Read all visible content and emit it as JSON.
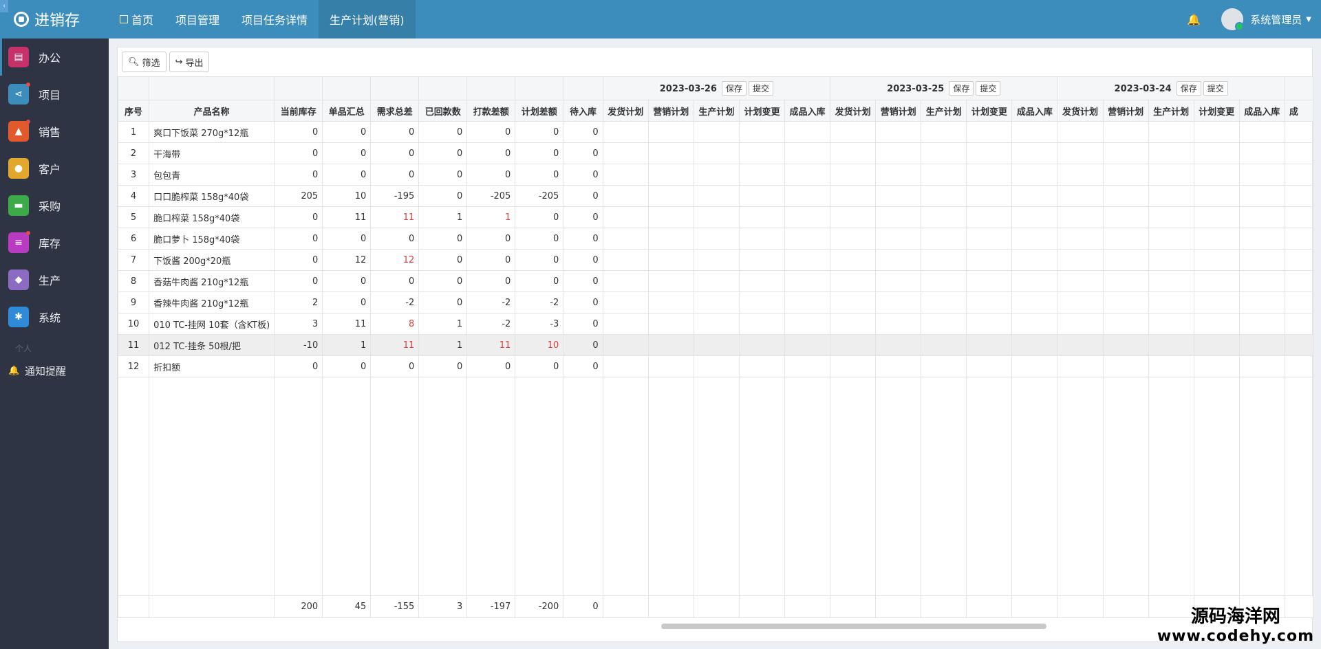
{
  "app": {
    "title": "进销存"
  },
  "sidebar": {
    "items": [
      {
        "label": "办公",
        "icon": "document-icon",
        "color": "#c73169",
        "dot": false
      },
      {
        "label": "项目",
        "icon": "share-icon",
        "color": "#3c8dbc",
        "dot": true
      },
      {
        "label": "销售",
        "icon": "road-icon",
        "color": "#e25a2c",
        "dot": true
      },
      {
        "label": "客户",
        "icon": "users-icon",
        "color": "#e3a82b",
        "dot": false
      },
      {
        "label": "采购",
        "icon": "cart-icon",
        "color": "#3daa4a",
        "dot": false
      },
      {
        "label": "库存",
        "icon": "database-icon",
        "color": "#b83bc1",
        "dot": true
      },
      {
        "label": "生产",
        "icon": "cube-icon",
        "color": "#8c6bc3",
        "dot": false
      },
      {
        "label": "系统",
        "icon": "gears-icon",
        "color": "#2f8ad8",
        "dot": false
      }
    ],
    "section_label": "个人",
    "notice_label": "通知提醒"
  },
  "topbar": {
    "tabs": [
      {
        "label": "首页",
        "active": false,
        "home": true
      },
      {
        "label": "项目管理",
        "active": false,
        "home": false
      },
      {
        "label": "项目任务详情",
        "active": false,
        "home": false
      },
      {
        "label": "生产计划(营销)",
        "active": true,
        "home": false
      }
    ],
    "user_name": "系统管理员"
  },
  "toolbar": {
    "filter_label": "筛选",
    "export_label": "导出"
  },
  "table": {
    "fixed_headers": [
      "序号",
      "产品名称",
      "当前库存",
      "单品汇总",
      "需求总差",
      "已回款数",
      "打款差额",
      "计划差额",
      "待入库"
    ],
    "date_groups": [
      {
        "date": "2023-03-26",
        "save": "保存",
        "submit": "提交"
      },
      {
        "date": "2023-03-25",
        "save": "保存",
        "submit": "提交"
      },
      {
        "date": "2023-03-24",
        "save": "保存",
        "submit": "提交"
      }
    ],
    "sub_headers": [
      "发货计划",
      "营销计划",
      "生产计划",
      "计划变更",
      "成品入库"
    ],
    "partial_header": "成",
    "rows": [
      {
        "no": "1",
        "name": "爽口下饭菜 270g*12瓶",
        "vals": [
          "0",
          "0",
          "0",
          "0",
          "0",
          "0",
          "0"
        ],
        "red": []
      },
      {
        "no": "2",
        "name": "干海带",
        "vals": [
          "0",
          "0",
          "0",
          "0",
          "0",
          "0",
          "0"
        ],
        "red": []
      },
      {
        "no": "3",
        "name": "包包青",
        "vals": [
          "0",
          "0",
          "0",
          "0",
          "0",
          "0",
          "0"
        ],
        "red": []
      },
      {
        "no": "4",
        "name": "口口脆榨菜 158g*40袋",
        "vals": [
          "205",
          "10",
          "-195",
          "0",
          "-205",
          "-205",
          "0"
        ],
        "red": []
      },
      {
        "no": "5",
        "name": "脆口榨菜 158g*40袋",
        "vals": [
          "0",
          "11",
          "11",
          "1",
          "1",
          "0",
          "0"
        ],
        "red": [
          2,
          4
        ]
      },
      {
        "no": "6",
        "name": "脆口萝卜 158g*40袋",
        "vals": [
          "0",
          "0",
          "0",
          "0",
          "0",
          "0",
          "0"
        ],
        "red": []
      },
      {
        "no": "7",
        "name": "下饭酱 200g*20瓶",
        "vals": [
          "0",
          "12",
          "12",
          "0",
          "0",
          "0",
          "0"
        ],
        "red": [
          2
        ]
      },
      {
        "no": "8",
        "name": "香菇牛肉酱 210g*12瓶",
        "vals": [
          "0",
          "0",
          "0",
          "0",
          "0",
          "0",
          "0"
        ],
        "red": []
      },
      {
        "no": "9",
        "name": "香辣牛肉酱 210g*12瓶",
        "vals": [
          "2",
          "0",
          "-2",
          "0",
          "-2",
          "-2",
          "0"
        ],
        "red": []
      },
      {
        "no": "10",
        "name": "010 TC-挂网 10套（含KT板)",
        "vals": [
          "3",
          "11",
          "8",
          "1",
          "-2",
          "-3",
          "0"
        ],
        "red": [
          2
        ]
      },
      {
        "no": "11",
        "name": "012 TC-挂条 50根/把",
        "vals": [
          "-10",
          "1",
          "11",
          "1",
          "11",
          "10",
          "0"
        ],
        "red": [
          2,
          4,
          5
        ],
        "highlight": true
      },
      {
        "no": "12",
        "name": "折扣额",
        "vals": [
          "0",
          "0",
          "0",
          "0",
          "0",
          "0",
          "0"
        ],
        "red": []
      }
    ],
    "totals": [
      "200",
      "45",
      "-155",
      "3",
      "-197",
      "-200",
      "0"
    ]
  },
  "watermark": {
    "line1": "源码海洋网",
    "line2": "www.codehy.com"
  }
}
